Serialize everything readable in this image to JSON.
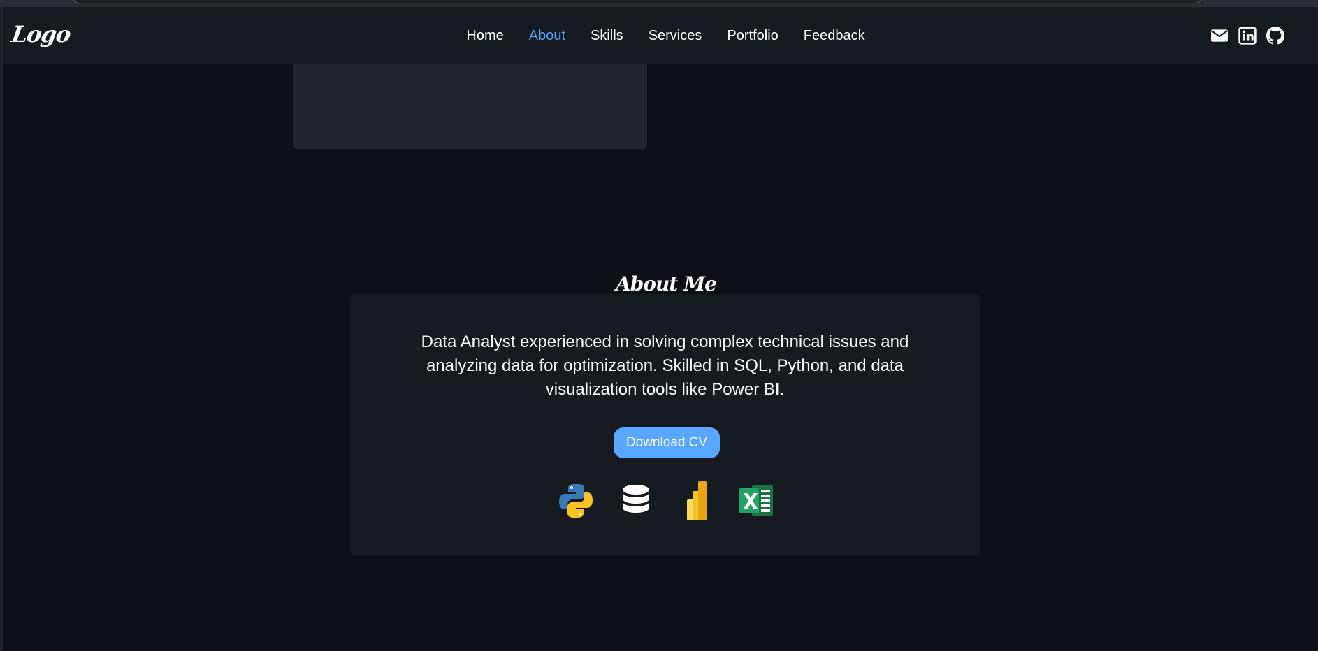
{
  "navbar": {
    "logo": "Logo",
    "links": [
      {
        "label": "Home",
        "active": false
      },
      {
        "label": "About",
        "active": true
      },
      {
        "label": "Skills",
        "active": false
      },
      {
        "label": "Services",
        "active": false
      },
      {
        "label": "Portfolio",
        "active": false
      },
      {
        "label": "Feedback",
        "active": false
      }
    ],
    "social_icons": [
      "envelope-icon",
      "linkedin-icon",
      "github-icon"
    ]
  },
  "about": {
    "title": "About Me",
    "description": "Data Analyst experienced in solving complex technical issues and analyzing data for optimization. Skilled in SQL, Python, and data visualization tools like Power BI.",
    "cv_button": "Download CV",
    "tool_icons": [
      "python-icon",
      "database-icon",
      "power-bi-icon",
      "excel-icon"
    ]
  },
  "colors": {
    "background": "#0d1117",
    "navbar": "#161b22",
    "card": "#161b22",
    "accent": "#58a6ff",
    "text": "#ffffff"
  }
}
